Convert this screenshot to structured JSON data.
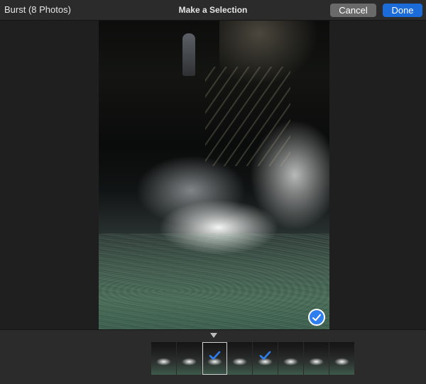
{
  "window": {
    "left_title": "Burst (8 Photos)",
    "center_title": "Make a Selection"
  },
  "toolbar": {
    "cancel_label": "Cancel",
    "done_label": "Done"
  },
  "colors": {
    "done_button": "#1b6bd8",
    "cancel_button": "#6a6a6a",
    "selection_check": "#2f7ef0",
    "background": "#1f1f1f"
  },
  "main_photo": {
    "selected": true,
    "icon": "checkmark-circle-icon"
  },
  "filmstrip": {
    "count": 8,
    "current_index": 2,
    "thumbnails": [
      {
        "selected": false
      },
      {
        "selected": false
      },
      {
        "selected": true
      },
      {
        "selected": false
      },
      {
        "selected": true
      },
      {
        "selected": false
      },
      {
        "selected": false
      },
      {
        "selected": false
      }
    ]
  }
}
